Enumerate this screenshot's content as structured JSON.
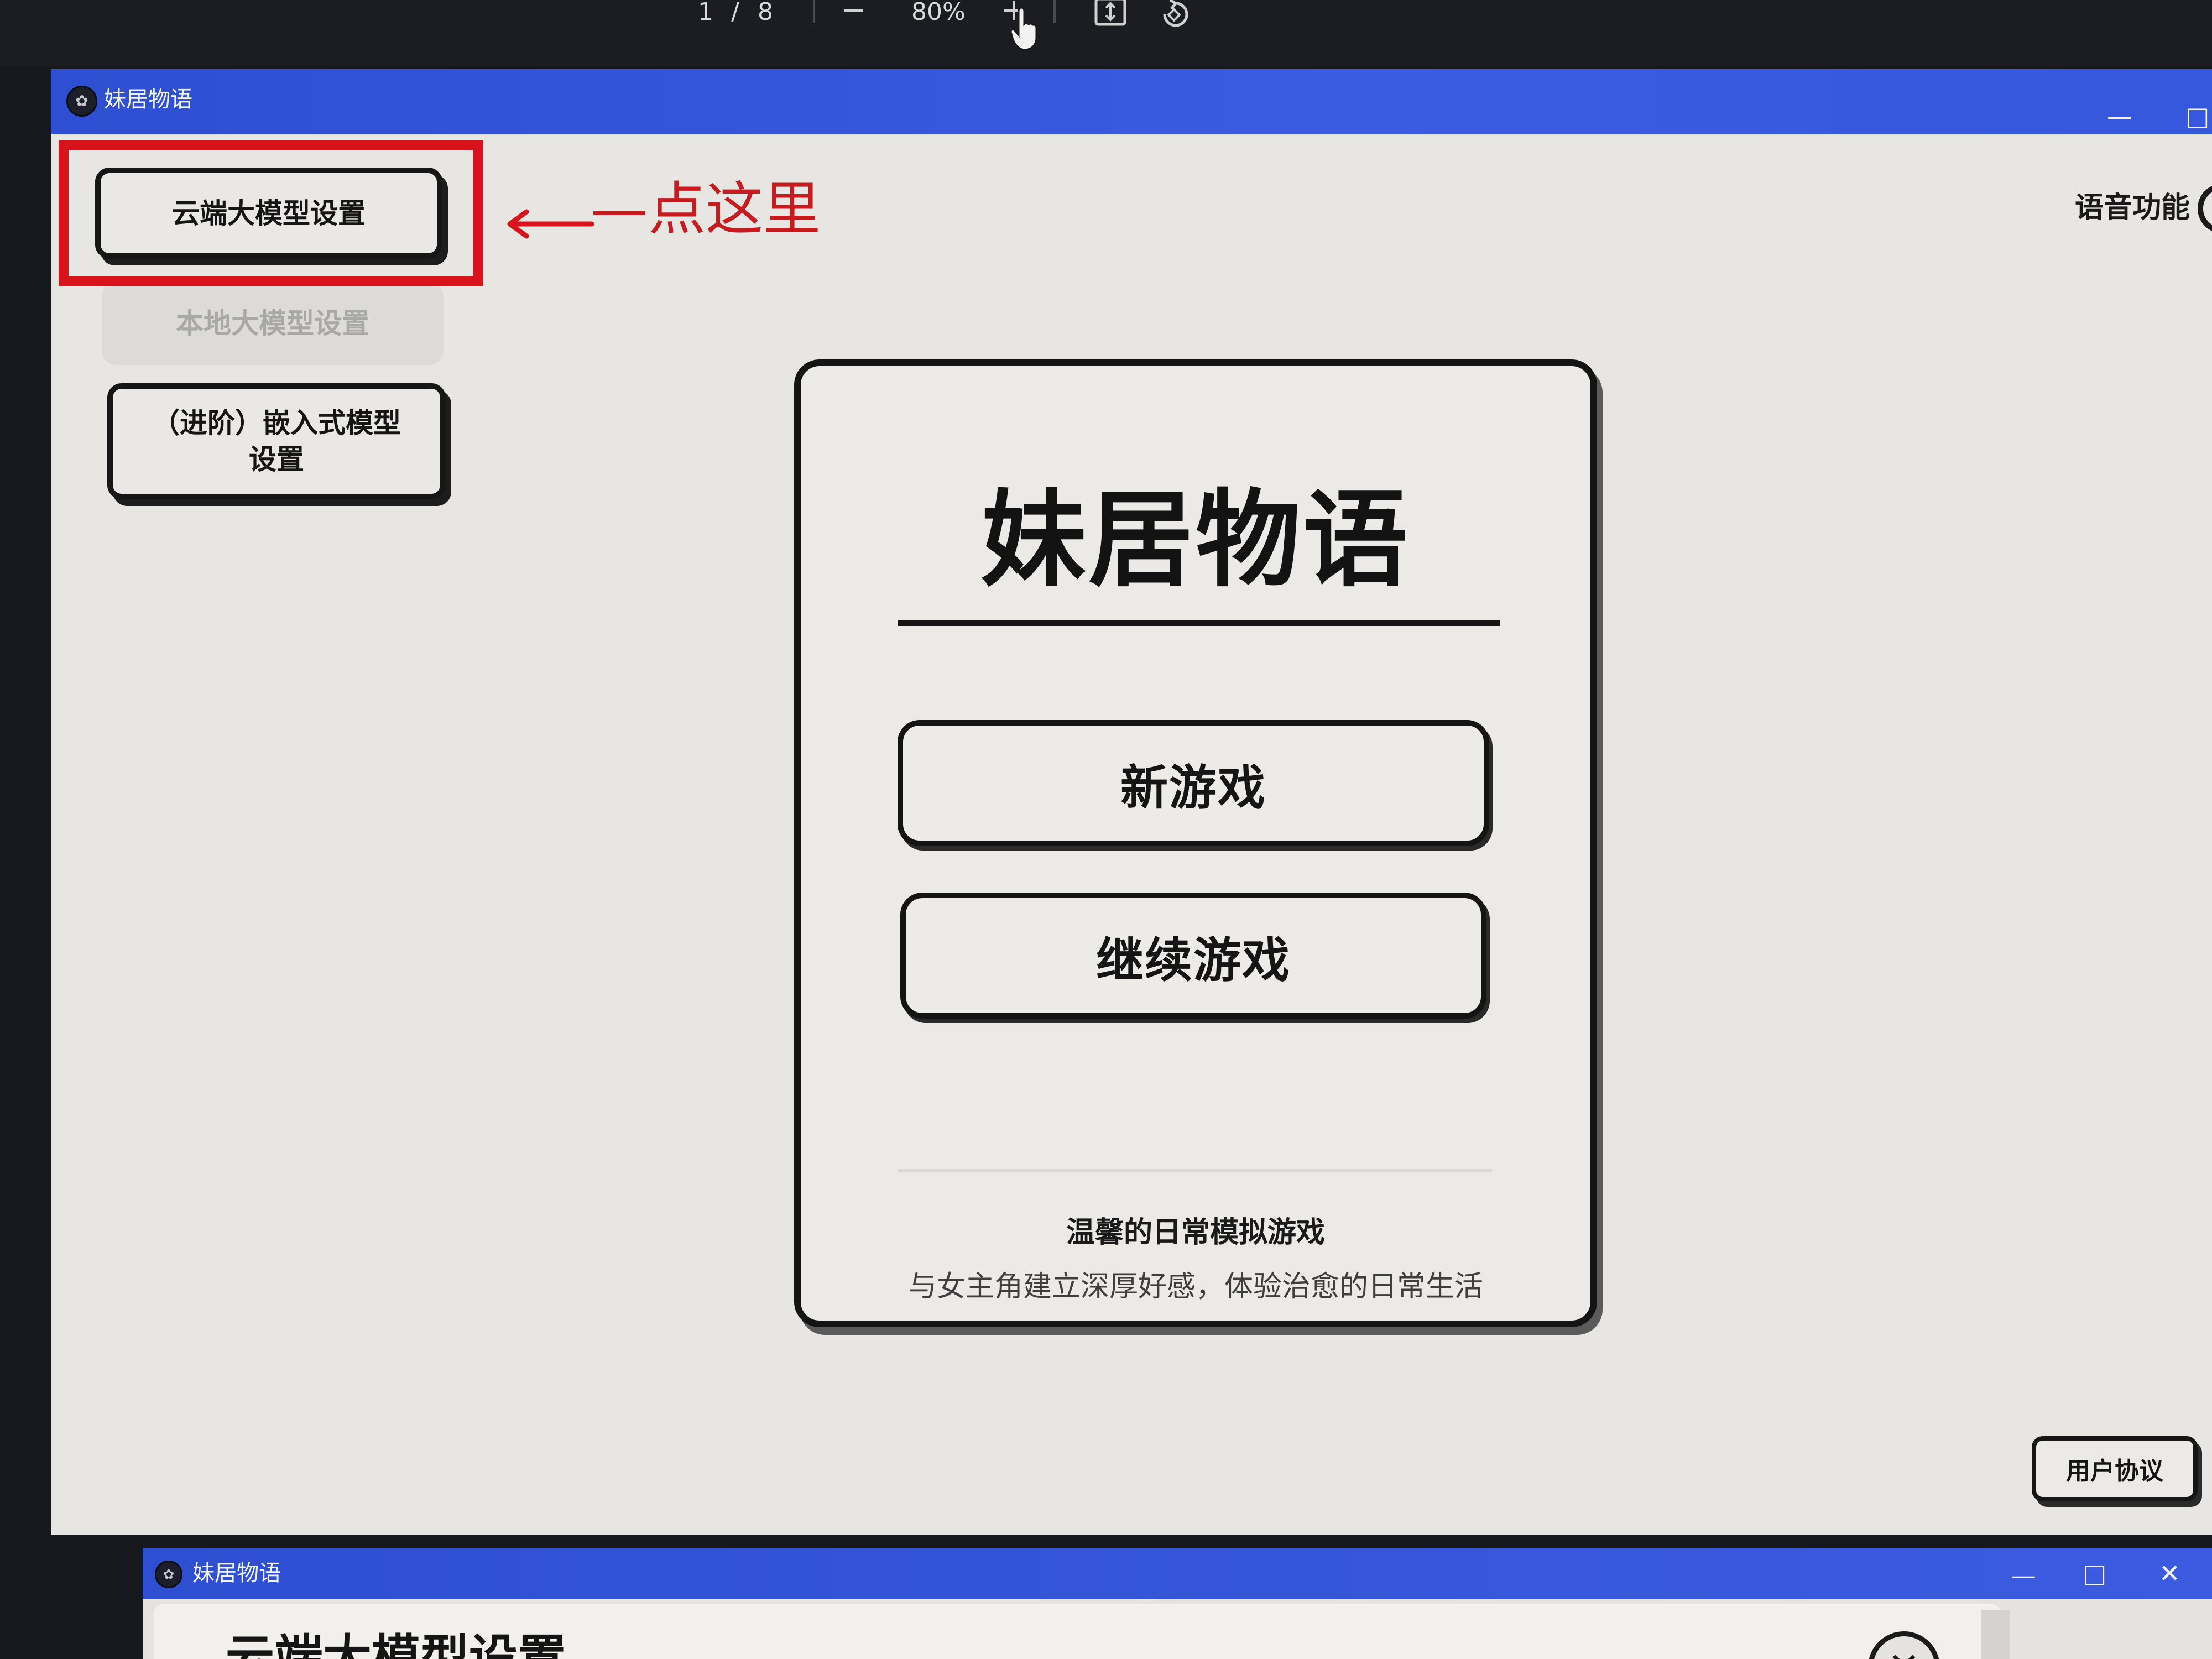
{
  "viewer_toolbar": {
    "current_page": "1",
    "page_separator": "/",
    "total_pages": "8",
    "zoom_out_icon": "minus-icon",
    "zoom_level": "80%",
    "zoom_in_icon": "plus-icon",
    "fit_page_icon": "fit-page-icon",
    "rotate_icon": "rotate-icon"
  },
  "main_window": {
    "title": "妹居物语",
    "controls": {
      "minimize": "—",
      "maximize": "□"
    },
    "sidebar": {
      "cloud_model_button": "云端大模型设置",
      "local_model_button": "本地大模型设置",
      "embedded_model_button_line1": "（进阶）嵌入式模型",
      "embedded_model_button_line2": "设置"
    },
    "annotation": {
      "arrow": "←",
      "text": "—点这里",
      "color": "#d8131b"
    },
    "voice_label": "语音功能",
    "card": {
      "title": "妹居物语",
      "new_game_button": "新游戏",
      "continue_button": "继续游戏",
      "tagline": "温馨的日常模拟游戏",
      "subtagline": "与女主角建立深厚好感，体验治愈的日常生活"
    },
    "user_agreement_button": "用户协议"
  },
  "second_window": {
    "title": "妹居物语",
    "controls": {
      "minimize": "—",
      "maximize": "□",
      "close": "✕"
    },
    "heading": "云端大模型设置",
    "close_icon": "close-icon"
  },
  "colors": {
    "title_bar_blue": "#2f4fd2",
    "annotation_red": "#d8131b",
    "background": "#e7e6e3",
    "ink": "#151515"
  }
}
